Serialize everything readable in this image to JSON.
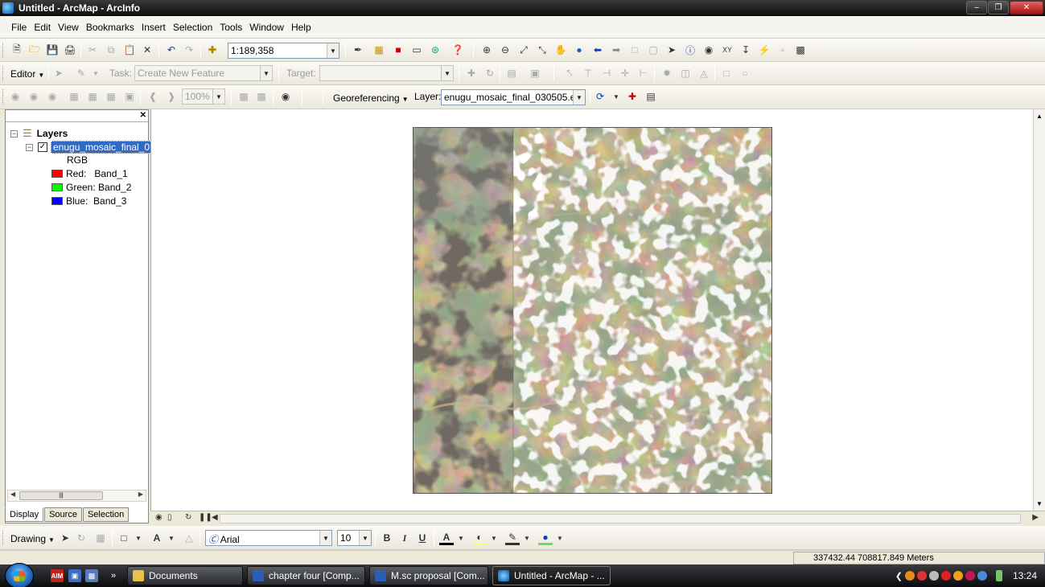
{
  "window": {
    "title": "Untitled - ArcMap - ArcInfo"
  },
  "menu": [
    "File",
    "Edit",
    "View",
    "Bookmarks",
    "Insert",
    "Selection",
    "Tools",
    "Window",
    "Help"
  ],
  "standard_toolbar": {
    "scale": "1:189,358"
  },
  "editor_toolbar": {
    "editor_label": "Editor",
    "task_label": "Task:",
    "task_value": "Create New Feature",
    "target_label": "Target:",
    "target_value": ""
  },
  "georef_toolbar": {
    "zoom_value": "100%",
    "georeferencing_label": "Georeferencing",
    "layer_label": "Layer:",
    "layer_value": "enugu_mosaic_final_030505.ecw"
  },
  "toc": {
    "root_label": "Layers",
    "layer_name": "enugu_mosaic_final_0",
    "renderer_label": "RGB",
    "bands": [
      {
        "label": "Red:   Band_1",
        "color": "#ff0000"
      },
      {
        "label": "Green: Band_2",
        "color": "#00ff00"
      },
      {
        "label": "Blue:  Band_3",
        "color": "#0000ff"
      }
    ],
    "tabs": [
      "Display",
      "Source",
      "Selection"
    ]
  },
  "drawing_toolbar": {
    "drawing_label": "Drawing",
    "font_name": "Arial",
    "font_size": "10",
    "bold_label": "B",
    "italic_label": "I",
    "underline_label": "U",
    "text_tool_label": "A"
  },
  "status": {
    "coordinates": "337432.44  708817.849 Meters"
  },
  "taskbar": {
    "tasks": [
      "Documents",
      "chapter four [Comp...",
      "M.sc proposal [Com...",
      "Untitled - ArcMap - ..."
    ],
    "clock": "13:24"
  },
  "colors": {
    "selection_highlight": "#316ac5",
    "title_bar": "#1a1a1a"
  }
}
